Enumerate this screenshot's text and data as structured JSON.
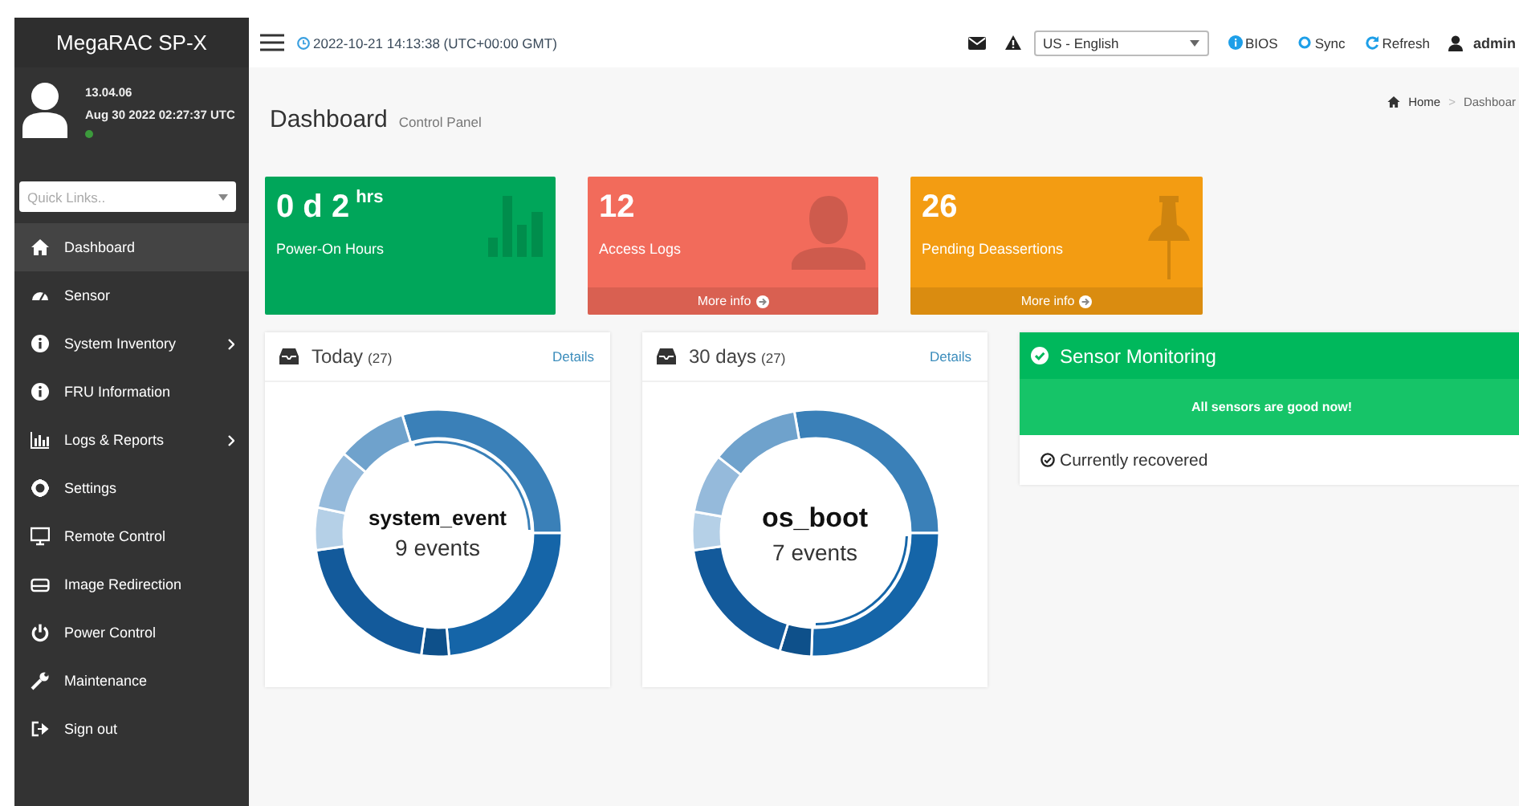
{
  "sidebar": {
    "brand": "MegaRAC SP-X",
    "user": {
      "version": "13.04.06",
      "date": "Aug 30 2022 02:27:37 UTC",
      "online": true
    },
    "quick_links": {
      "placeholder": "Quick Links.."
    },
    "items": [
      {
        "label": "Dashboard",
        "selected": true,
        "submenu": false
      },
      {
        "label": "Sensor",
        "selected": false,
        "submenu": false
      },
      {
        "label": "System Inventory",
        "selected": false,
        "submenu": true
      },
      {
        "label": "FRU Information",
        "selected": false,
        "submenu": false
      },
      {
        "label": "Logs & Reports",
        "selected": false,
        "submenu": true
      },
      {
        "label": "Settings",
        "selected": false,
        "submenu": false
      },
      {
        "label": "Remote Control",
        "selected": false,
        "submenu": false
      },
      {
        "label": "Image Redirection",
        "selected": false,
        "submenu": false
      },
      {
        "label": "Power Control",
        "selected": false,
        "submenu": false
      },
      {
        "label": "Maintenance",
        "selected": false,
        "submenu": false
      },
      {
        "label": "Sign out",
        "selected": false,
        "submenu": false
      }
    ]
  },
  "header": {
    "datetime": "2022-10-21 14:13:38 (UTC+00:00 GMT)",
    "language": "US - English",
    "links": [
      "BIOS",
      "Sync",
      "Refresh"
    ],
    "user": "admin"
  },
  "page": {
    "title": "Dashboard",
    "subtitle": "Control Panel",
    "breadcrumb": [
      "Home",
      "Dashboar"
    ],
    "separator": ">"
  },
  "stat_cards": [
    {
      "value": "0 d 2",
      "unit": "hrs",
      "label": "Power-On Hours",
      "color": "#00a65a"
    },
    {
      "value": "12",
      "label": "Access Logs",
      "color": "#f26b5b",
      "more_info": "More info"
    },
    {
      "value": "26",
      "label": "Pending Deassertions",
      "color": "#f39c12",
      "more_info": "More info"
    }
  ],
  "event_panels": [
    {
      "title": "Today",
      "count": "(27)",
      "link": "Details",
      "center_label": "system_event",
      "center_sub": "9 events"
    },
    {
      "title": "30 days",
      "count": "(27)",
      "link": "Details",
      "center_label": "os_boot",
      "center_sub": "7 events"
    }
  ],
  "sensor_monitoring": {
    "title": "Sensor Monitoring",
    "message": "All sensors are good now!",
    "status": "Currently recovered"
  }
}
